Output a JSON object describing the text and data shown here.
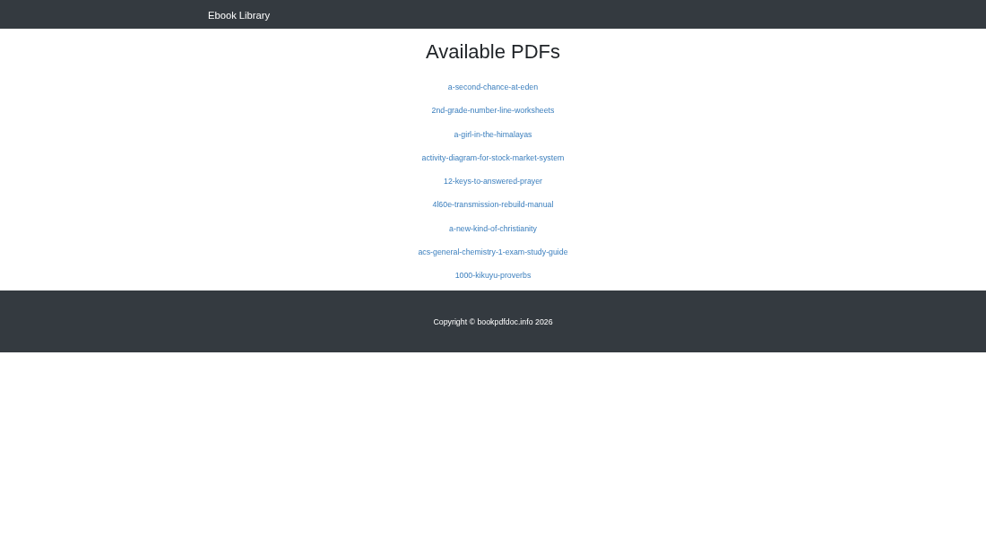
{
  "navbar": {
    "brand": "Ebook Library"
  },
  "main": {
    "title": "Available PDFs",
    "links": [
      "a-second-chance-at-eden",
      "2nd-grade-number-line-worksheets",
      "a-girl-in-the-himalayas",
      "activity-diagram-for-stock-market-system",
      "12-keys-to-answered-prayer",
      "4l60e-transmission-rebuild-manual",
      "a-new-kind-of-christianity",
      "acs-general-chemistry-1-exam-study-guide",
      "1000-kikuyu-proverbs"
    ]
  },
  "footer": {
    "copyright": "Copyright © bookpdfdoc.info 2026"
  }
}
